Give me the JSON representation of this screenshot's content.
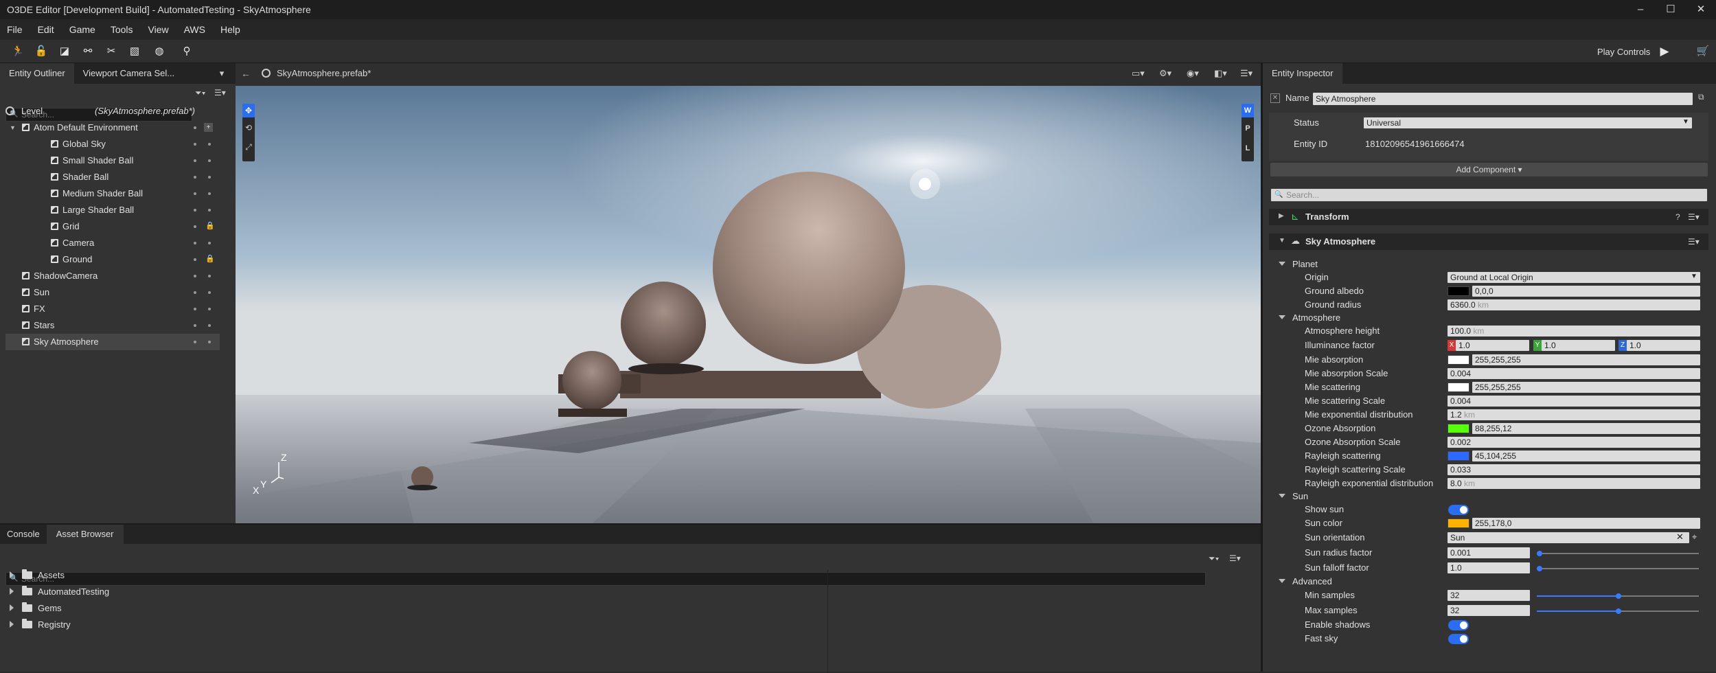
{
  "window": {
    "title": "O3DE Editor [Development Build] - AutomatedTesting - SkyAtmosphere",
    "min_glyph": "–",
    "max_glyph": "☐",
    "close_glyph": "✕"
  },
  "menu": [
    "File",
    "Edit",
    "Game",
    "Tools",
    "View",
    "AWS",
    "Help"
  ],
  "toolbar": {
    "play_controls": "Play Controls"
  },
  "outliner": {
    "tabs": [
      "Entity Outliner",
      "Viewport Camera Sel..."
    ],
    "search_placeholder": "Search...",
    "level_label": "Level",
    "level_file": "(SkyAtmosphere.prefab*)",
    "items": [
      {
        "label": "Atom Default Environment",
        "indent": 1,
        "expanded": true
      },
      {
        "label": "Global Sky",
        "indent": 2
      },
      {
        "label": "Small Shader Ball",
        "indent": 2
      },
      {
        "label": "Shader Ball",
        "indent": 2
      },
      {
        "label": "Medium Shader Ball",
        "indent": 2
      },
      {
        "label": "Large Shader Ball",
        "indent": 2
      },
      {
        "label": "Grid",
        "indent": 2
      },
      {
        "label": "Camera",
        "indent": 2
      },
      {
        "label": "Ground",
        "indent": 2
      },
      {
        "label": "ShadowCamera",
        "indent": 1
      },
      {
        "label": "Sun",
        "indent": 1
      },
      {
        "label": "FX",
        "indent": 1
      },
      {
        "label": "Stars",
        "indent": 1
      },
      {
        "label": "Sky Atmosphere",
        "indent": 1,
        "selected": true
      }
    ]
  },
  "viewport": {
    "tab": "SkyAtmosphere.prefab*",
    "axis_z": "Z",
    "axis_x": "X",
    "axis_y": "Y",
    "side_labels": [
      "W",
      "P",
      "L"
    ]
  },
  "inspector": {
    "tab": "Entity Inspector",
    "name_label": "Name",
    "name_value": "Sky Atmosphere",
    "status_label": "Status",
    "status_value": "Universal",
    "entity_id_label": "Entity ID",
    "entity_id_value": "18102096541961666474",
    "add_component": "Add Component ▾",
    "search_placeholder": "Search...",
    "transform_label": "Transform",
    "sky_label": "Sky Atmosphere",
    "planet": {
      "header": "Planet",
      "origin_label": "Origin",
      "origin_value": "Ground at Local Origin",
      "albedo_label": "Ground albedo",
      "albedo_value": "0,0,0",
      "radius_label": "Ground radius",
      "radius_value": "6360.0",
      "radius_unit": "km"
    },
    "atmosphere": {
      "header": "Atmosphere",
      "height_label": "Atmosphere height",
      "height_value": "100.0",
      "height_unit": "km",
      "illum_label": "Illuminance factor",
      "illum_x": "1.0",
      "illum_y": "1.0",
      "illum_z": "1.0",
      "mie_abs_label": "Mie absorption",
      "mie_abs_value": "255,255,255",
      "mie_abs_scale_label": "Mie absorption Scale",
      "mie_abs_scale_value": "0.004",
      "mie_sc_label": "Mie scattering",
      "mie_sc_value": "255,255,255",
      "mie_sc_scale_label": "Mie scattering Scale",
      "mie_sc_scale_value": "0.004",
      "mie_exp_label": "Mie exponential distribution",
      "mie_exp_value": "1.2",
      "mie_exp_unit": "km",
      "ozone_label": "Ozone Absorption",
      "ozone_value": "88,255,12",
      "ozone_scale_label": "Ozone Absorption Scale",
      "ozone_scale_value": "0.002",
      "ray_label": "Rayleigh scattering",
      "ray_value": "45,104,255",
      "ray_scale_label": "Rayleigh scattering Scale",
      "ray_scale_value": "0.033",
      "ray_exp_label": "Rayleigh exponential distribution",
      "ray_exp_value": "8.0",
      "ray_exp_unit": "km"
    },
    "sun": {
      "header": "Sun",
      "show_label": "Show sun",
      "color_label": "Sun color",
      "color_value": "255,178,0",
      "orient_label": "Sun orientation",
      "orient_value": "Sun",
      "radius_label": "Sun radius factor",
      "radius_value": "0.001",
      "falloff_label": "Sun falloff factor",
      "falloff_value": "1.0"
    },
    "advanced": {
      "header": "Advanced",
      "min_label": "Min samples",
      "min_value": "32",
      "max_label": "Max samples",
      "max_value": "32",
      "shadows_label": "Enable shadows",
      "fast_label": "Fast sky"
    }
  },
  "bottom": {
    "tabs": [
      "Console",
      "Asset Browser"
    ],
    "search_placeholder": "Search...",
    "folders": [
      "Assets",
      "AutomatedTesting",
      "Gems",
      "Registry"
    ]
  },
  "colors": {
    "ground_albedo": "#000000",
    "mie_absorption": "#ffffff",
    "mie_scattering": "#ffffff",
    "ozone": "#58ff0c",
    "rayleigh": "#2d68ff",
    "sun_color": "#ffb200",
    "accent": "#2a6df0",
    "selection": "#454545"
  }
}
